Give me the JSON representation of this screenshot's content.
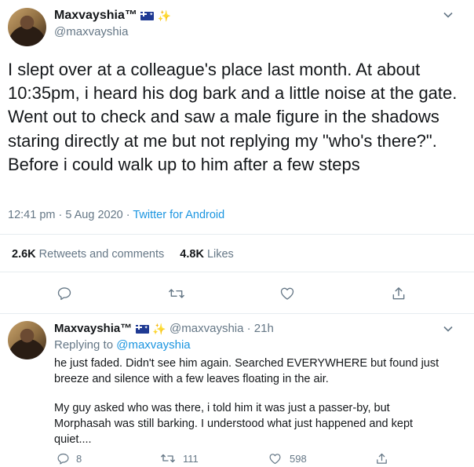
{
  "main_tweet": {
    "display_name": "Maxvayshia™",
    "handle": "@maxvayshia",
    "text": "I slept over at a colleague's place last month. At about 10:35pm, i heard his dog bark and a little noise at the gate. Went out to check and saw a male figure in the shadows staring directly at me but not replying my \"who's there?\". Before i could walk up to him after a few steps",
    "time": "12:41 pm · 5 Aug 2020 · ",
    "source": "Twitter for Android",
    "retweets_count": "2.6K",
    "retweets_label": "Retweets and comments",
    "likes_count": "4.8K",
    "likes_label": "Likes"
  },
  "reply_tweet": {
    "display_name": "Maxvayshia™",
    "handle_time": "@maxvayshia · 21h",
    "replying_to_label": "Replying to ",
    "replying_to_handle": "@maxvayshia",
    "paragraph_1": "he just faded. Didn't see him again. Searched EVERYWHERE but found just breeze and silence with a few leaves floating in the air.",
    "paragraph_2": "My guy asked who was there, i told him it was just a passer-by, but Morphasah was still barking. I understood what just happened and kept quiet....",
    "reply_count": "8",
    "retweet_count": "111",
    "like_count": "598"
  },
  "icons": [
    "chevron-down-icon",
    "reply-icon",
    "retweet-icon",
    "like-icon",
    "share-icon",
    "australia-flag-icon",
    "sparkles-icon"
  ],
  "colors": {
    "link": "#1b95e0",
    "muted": "#657786",
    "text": "#14171a",
    "divider": "#e6ecf0"
  }
}
